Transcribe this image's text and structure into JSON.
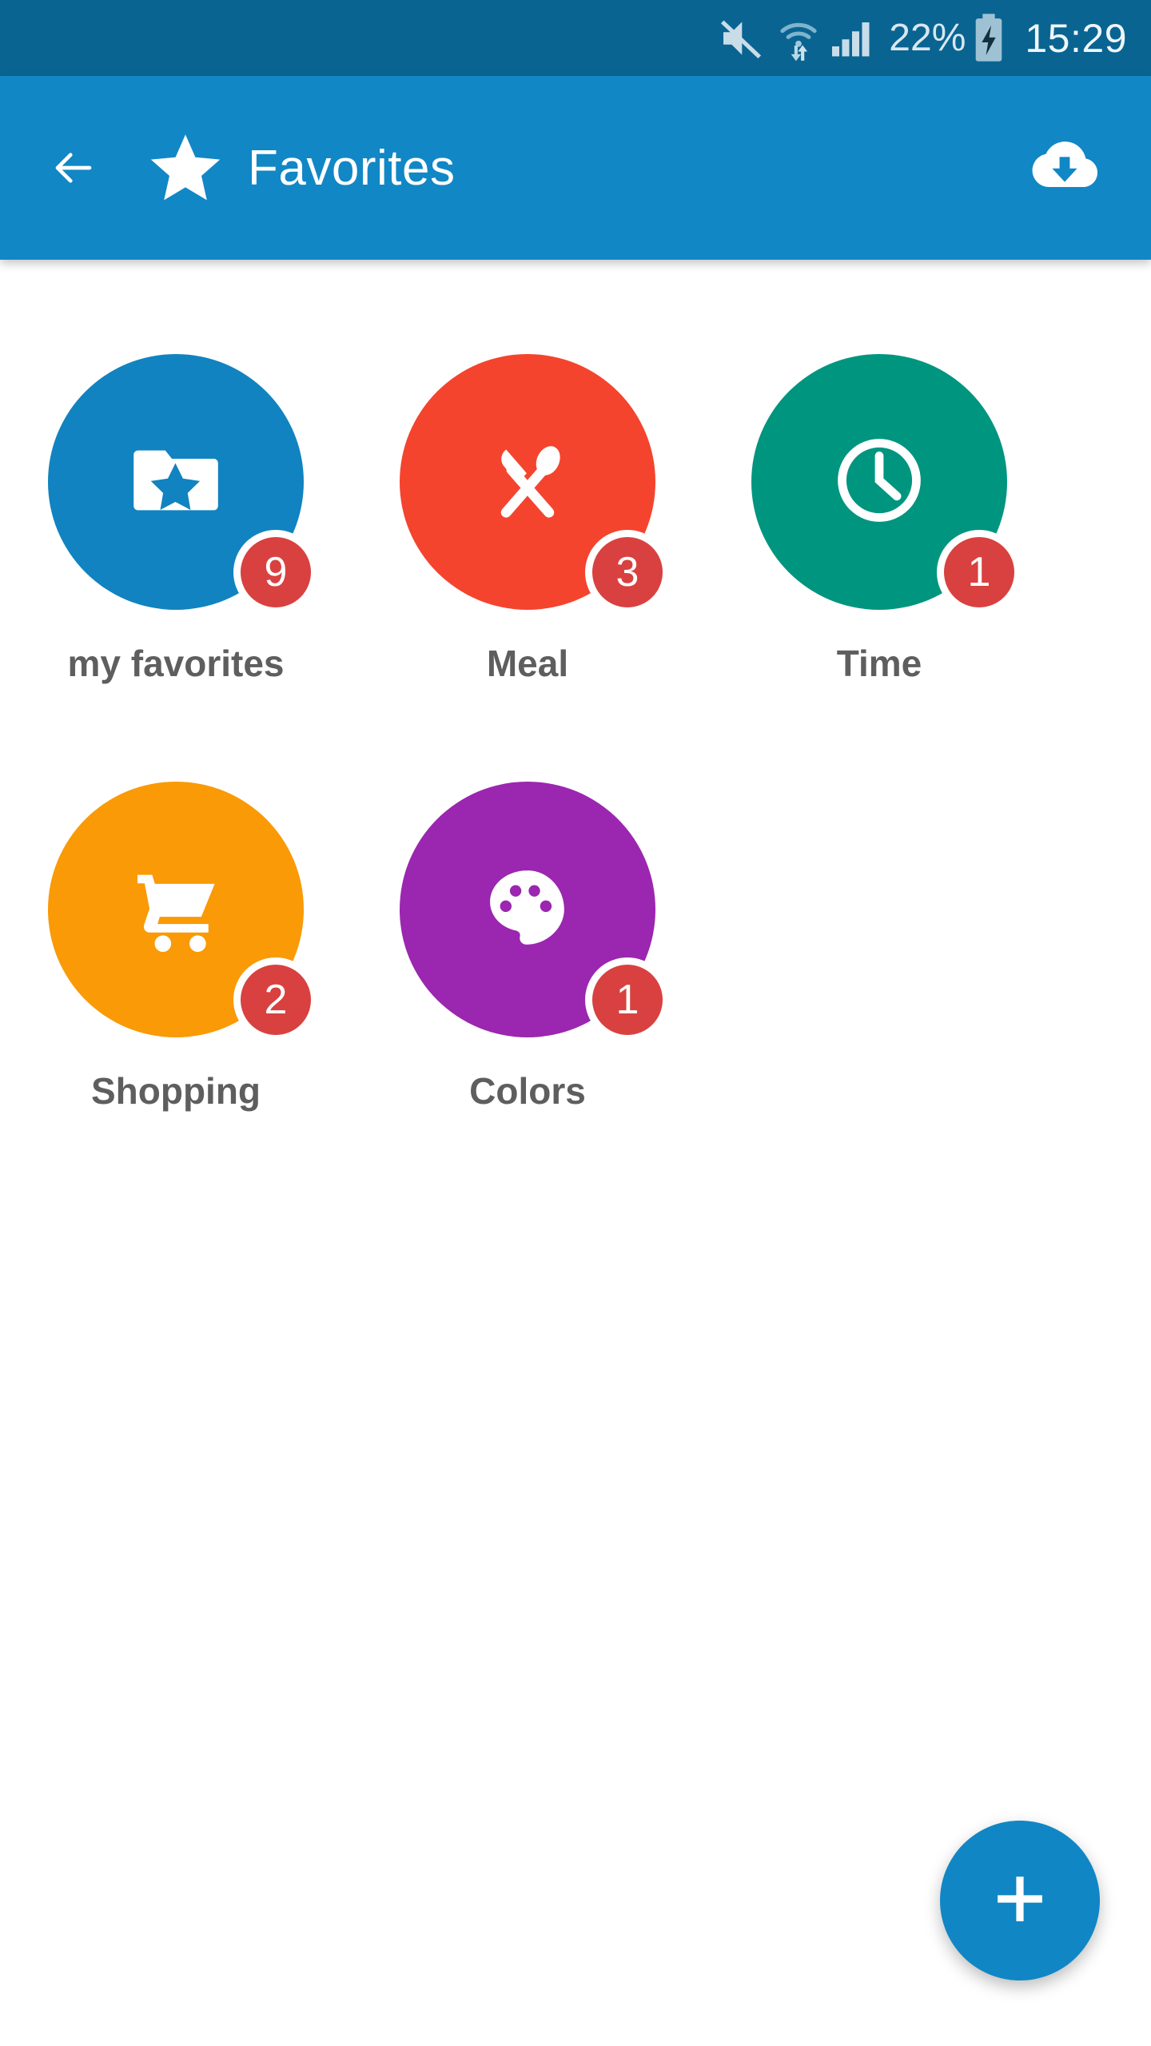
{
  "status_bar": {
    "background": "#0a6492",
    "mute_icon": "mute-icon",
    "wifi_icon": "wifi-data-icon",
    "signal_icon": "signal-bars-icon",
    "battery_percent": "22%",
    "battery_icon": "battery-charging-icon",
    "time": "15:29"
  },
  "app_bar": {
    "background": "#1187c6",
    "back_icon": "back-arrow-icon",
    "brand_icon": "star-icon",
    "title": "Favorites",
    "action_icon": "cloud-download-icon"
  },
  "grid": {
    "items": [
      {
        "label": "my favorites",
        "badge": "9",
        "color": "#1183c0",
        "icon": "folder-star-icon"
      },
      {
        "label": "Meal",
        "badge": "3",
        "color": "#f4442e",
        "icon": "cutlery-icon"
      },
      {
        "label": "Time",
        "badge": "1",
        "color": "#00957f",
        "icon": "clock-icon"
      },
      {
        "label": "Shopping",
        "badge": "2",
        "color": "#f99a06",
        "icon": "shopping-cart-icon"
      },
      {
        "label": "Colors",
        "badge": "1",
        "color": "#9b26b0",
        "icon": "paint-palette-icon"
      }
    ],
    "badge_color": "#d8413f",
    "label_color": "#5e5e5e"
  },
  "fab": {
    "label": "+",
    "color": "#1186c4",
    "icon": "plus-icon"
  }
}
